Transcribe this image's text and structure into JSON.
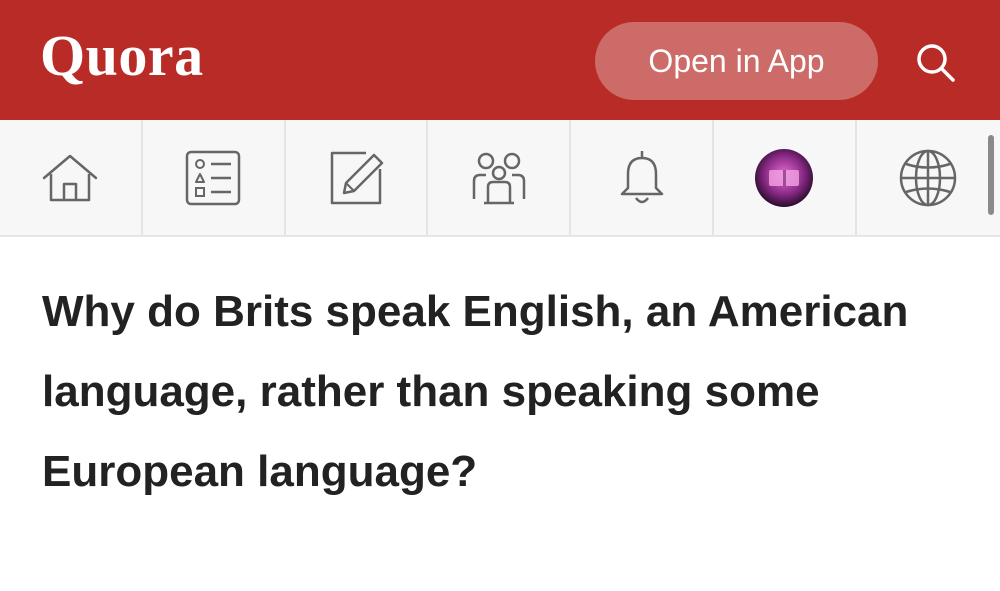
{
  "header": {
    "logo": "Quora",
    "open_app_label": "Open in App",
    "search_icon": "search-icon"
  },
  "nav": {
    "items": [
      {
        "icon": "home-icon"
      },
      {
        "icon": "answer-list-icon"
      },
      {
        "icon": "write-icon"
      },
      {
        "icon": "spaces-icon"
      },
      {
        "icon": "bell-icon"
      },
      {
        "icon": "profile-avatar"
      },
      {
        "icon": "globe-icon"
      }
    ]
  },
  "question": {
    "title": "Why do Brits speak English, an American language, rather than speaking some European language?"
  },
  "colors": {
    "brand": "#b92b27",
    "button_bg": "#cc6b67",
    "text": "#222222",
    "nav_bg": "#f7f7f7"
  }
}
